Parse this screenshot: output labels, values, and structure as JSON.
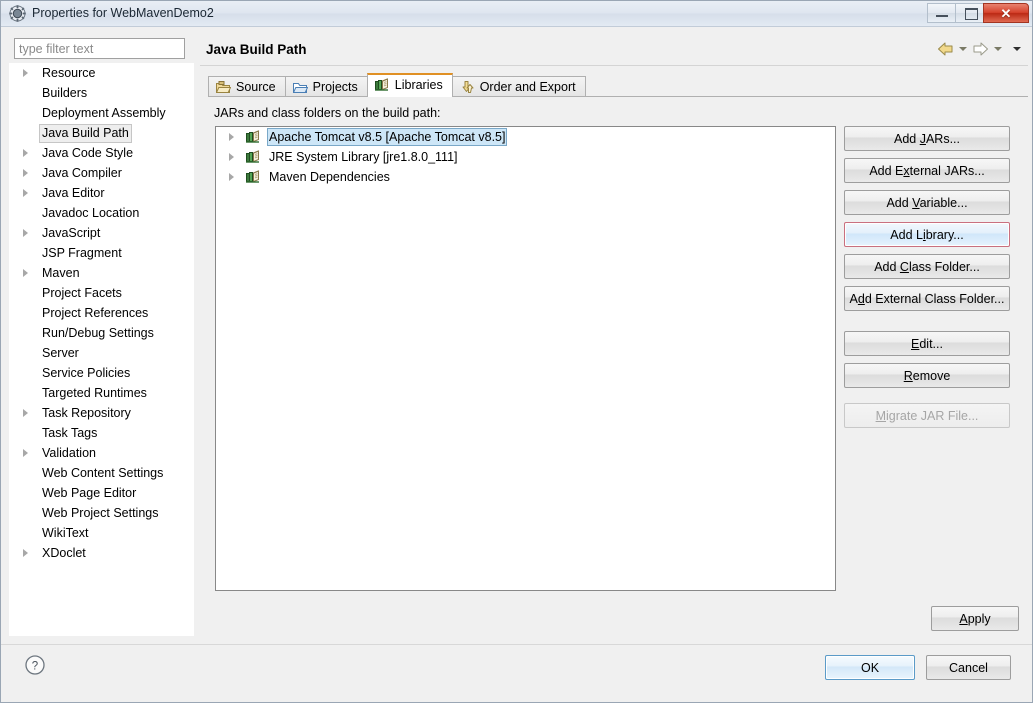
{
  "window": {
    "title": "Properties for WebMavenDemo2",
    "icon": "eclipse-properties-icon",
    "controls": {
      "minimize": "minimize-button",
      "maximize": "maximize-button",
      "close_glyph": "✕"
    }
  },
  "filter": {
    "placeholder": "type filter text",
    "value": ""
  },
  "sidebar": {
    "items": [
      {
        "label": "Resource",
        "expandable": true,
        "selected": false
      },
      {
        "label": "Builders",
        "expandable": false,
        "selected": false
      },
      {
        "label": "Deployment Assembly",
        "expandable": false,
        "selected": false
      },
      {
        "label": "Java Build Path",
        "expandable": false,
        "selected": true
      },
      {
        "label": "Java Code Style",
        "expandable": true,
        "selected": false
      },
      {
        "label": "Java Compiler",
        "expandable": true,
        "selected": false
      },
      {
        "label": "Java Editor",
        "expandable": true,
        "selected": false
      },
      {
        "label": "Javadoc Location",
        "expandable": false,
        "selected": false
      },
      {
        "label": "JavaScript",
        "expandable": true,
        "selected": false
      },
      {
        "label": "JSP Fragment",
        "expandable": false,
        "selected": false
      },
      {
        "label": "Maven",
        "expandable": true,
        "selected": false
      },
      {
        "label": "Project Facets",
        "expandable": false,
        "selected": false
      },
      {
        "label": "Project References",
        "expandable": false,
        "selected": false
      },
      {
        "label": "Run/Debug Settings",
        "expandable": false,
        "selected": false
      },
      {
        "label": "Server",
        "expandable": false,
        "selected": false
      },
      {
        "label": "Service Policies",
        "expandable": false,
        "selected": false
      },
      {
        "label": "Targeted Runtimes",
        "expandable": false,
        "selected": false
      },
      {
        "label": "Task Repository",
        "expandable": true,
        "selected": false
      },
      {
        "label": "Task Tags",
        "expandable": false,
        "selected": false
      },
      {
        "label": "Validation",
        "expandable": true,
        "selected": false
      },
      {
        "label": "Web Content Settings",
        "expandable": false,
        "selected": false
      },
      {
        "label": "Web Page Editor",
        "expandable": false,
        "selected": false
      },
      {
        "label": "Web Project Settings",
        "expandable": false,
        "selected": false
      },
      {
        "label": "WikiText",
        "expandable": false,
        "selected": false
      },
      {
        "label": "XDoclet",
        "expandable": true,
        "selected": false
      }
    ]
  },
  "main": {
    "page_title": "Java Build Path",
    "nav": {
      "back_icon": "back-arrow-icon",
      "back_menu_icon": "chevron-down-icon",
      "forward_icon": "forward-arrow-icon",
      "forward_menu_icon": "chevron-down-icon",
      "view_menu_icon": "chevron-down-icon"
    },
    "tabs": [
      {
        "label": "Source",
        "icon": "source-folder-icon",
        "active": false
      },
      {
        "label": "Projects",
        "icon": "projects-folder-icon",
        "active": false
      },
      {
        "label": "Libraries",
        "icon": "libraries-books-icon",
        "active": true
      },
      {
        "label": "Order and Export",
        "icon": "order-export-arrows-icon",
        "active": false
      }
    ],
    "list_label": "JARs and class folders on the build path:",
    "libraries": [
      {
        "label": "Apache Tomcat v8.5 [Apache Tomcat v8.5]",
        "icon": "library-icon",
        "expandable": true,
        "selected": true
      },
      {
        "label": "JRE System Library [jre1.8.0_111]",
        "icon": "library-icon",
        "expandable": true,
        "selected": false
      },
      {
        "label": "Maven Dependencies",
        "icon": "library-icon",
        "expandable": true,
        "selected": false
      }
    ],
    "buttons": [
      {
        "label": "Add JARs...",
        "mnemonic": "J",
        "state": "normal"
      },
      {
        "label": "Add External JARs...",
        "mnemonic": "x",
        "state": "normal"
      },
      {
        "label": "Add Variable...",
        "mnemonic": "V",
        "state": "normal"
      },
      {
        "label": "Add Library...",
        "mnemonic": "i",
        "state": "hovered"
      },
      {
        "label": "Add Class Folder...",
        "mnemonic": "C",
        "state": "normal"
      },
      {
        "label": "Add External Class Folder...",
        "mnemonic": "d",
        "state": "normal"
      },
      {
        "label": "Edit...",
        "mnemonic": "E",
        "state": "normal"
      },
      {
        "label": "Remove",
        "mnemonic": "R",
        "state": "normal"
      },
      {
        "label": "Migrate JAR File...",
        "mnemonic": "M",
        "state": "disabled"
      }
    ],
    "apply_label": "Apply",
    "apply_mnemonic": "A"
  },
  "footer": {
    "help_icon": "help-question-icon",
    "ok_label": "OK",
    "cancel_label": "Cancel"
  },
  "colors": {
    "tab_active_accent": "#e09024",
    "selection_blue": "#cde6f7",
    "hover_border": "#c9707f",
    "default_button_border": "#5b9bc8",
    "close_button_red": "#bb2914"
  }
}
